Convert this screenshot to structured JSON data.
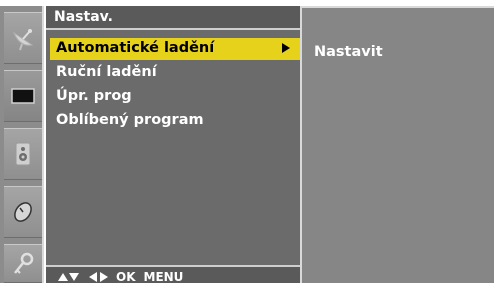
{
  "menu": {
    "title": "Nastav.",
    "items": [
      {
        "label": "Automatické ladění",
        "selected": true,
        "has_submenu": true
      },
      {
        "label": "Ruční ladění"
      },
      {
        "label": "Úpr. prog"
      },
      {
        "label": "Oblíbený program"
      }
    ],
    "footer": {
      "ok_label": "OK",
      "menu_label": "MENU"
    }
  },
  "submenu": {
    "items": [
      {
        "label": "Nastavit"
      }
    ]
  },
  "iconbar": {
    "icons": [
      "satellite-dish-icon",
      "screen-picture-icon",
      "speaker-sound-icon",
      "clock-time-icon",
      "key-lock-icon"
    ]
  },
  "colors": {
    "highlight": "#e7d21b",
    "panel": "#6b6b6b",
    "submenu_panel": "#868686"
  }
}
